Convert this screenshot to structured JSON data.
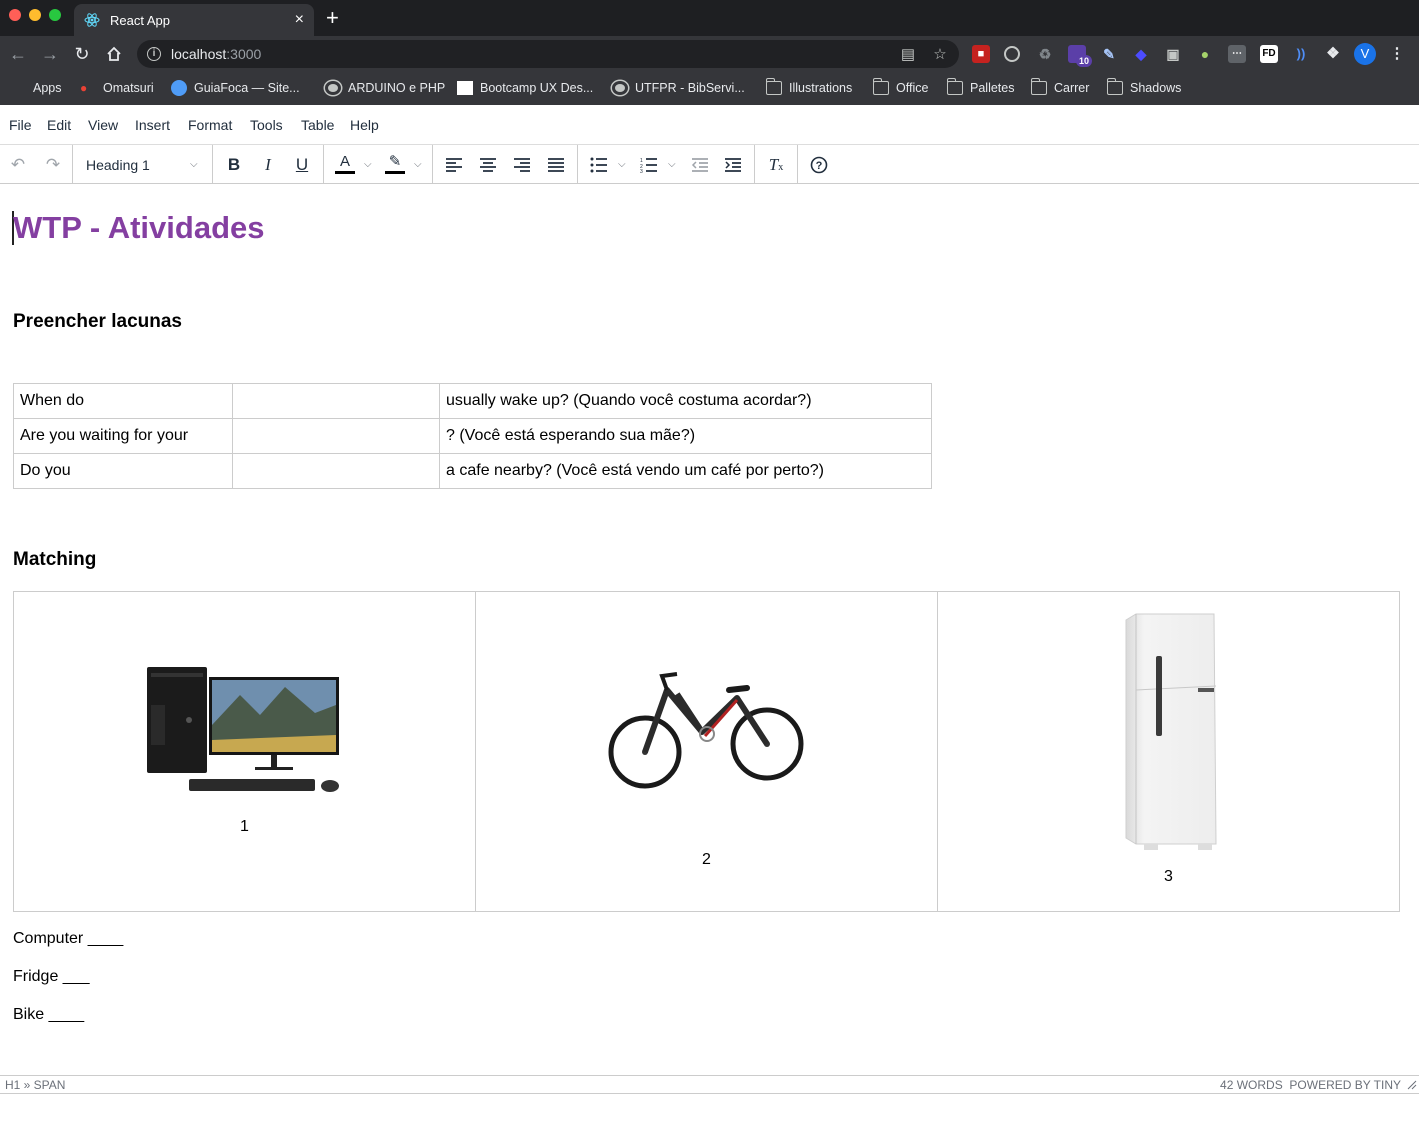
{
  "browser": {
    "tab_title": "React App",
    "tab_close": "×",
    "new_tab": "+",
    "url_host": "localhost",
    "url_port": ":3000",
    "profile_initial": "V",
    "extension_badge": "10",
    "ext_fd_label": "FD",
    "bookmarks": [
      {
        "label": "Apps",
        "icon": "apps-grid-icon"
      },
      {
        "label": "Omatsuri",
        "icon": "omatsuri-icon"
      },
      {
        "label": "GuiaFoca — Site...",
        "icon": "guiafoca-icon"
      },
      {
        "label": "ARDUINO e PHP",
        "icon": "globe-icon"
      },
      {
        "label": "Bootcamp UX Des...",
        "icon": "bootcamp-icon"
      },
      {
        "label": "UTFPR - BibServi...",
        "icon": "globe-icon"
      },
      {
        "label": "Illustrations",
        "icon": "folder-icon"
      },
      {
        "label": "Office",
        "icon": "folder-icon"
      },
      {
        "label": "Palletes",
        "icon": "folder-icon"
      },
      {
        "label": "Carrer",
        "icon": "folder-icon"
      },
      {
        "label": "Shadows",
        "icon": "folder-icon"
      }
    ]
  },
  "editor": {
    "menu": [
      "File",
      "Edit",
      "View",
      "Insert",
      "Format",
      "Tools",
      "Table",
      "Help"
    ],
    "block_format": "Heading 1",
    "colors": {
      "title": "#843fa1",
      "text_color_bar": "#000000",
      "highlight_bar": "#000000"
    }
  },
  "document": {
    "title": "WTP - Atividades",
    "section1_heading": "Preencher lacunas",
    "gap_rows": [
      [
        "When do",
        "",
        "usually wake up? (Quando você costuma acordar?)"
      ],
      [
        "Are you waiting for your",
        "",
        "? (Você está esperando sua mãe?)"
      ],
      [
        "Do you",
        "",
        "a cafe nearby? (Você está vendo um café por perto?)"
      ]
    ],
    "section2_heading": "Matching",
    "images": [
      {
        "label": "1",
        "icon": "desktop-computer-image"
      },
      {
        "label": "2",
        "icon": "bicycle-image"
      },
      {
        "label": "3",
        "icon": "refrigerator-image"
      }
    ],
    "answers": [
      "Computer ____",
      "Fridge ___",
      "Bike ____"
    ]
  },
  "statusbar": {
    "path": "H1 » SPAN",
    "word_count": "42 WORDS",
    "powered_by": "POWERED BY TINY"
  }
}
